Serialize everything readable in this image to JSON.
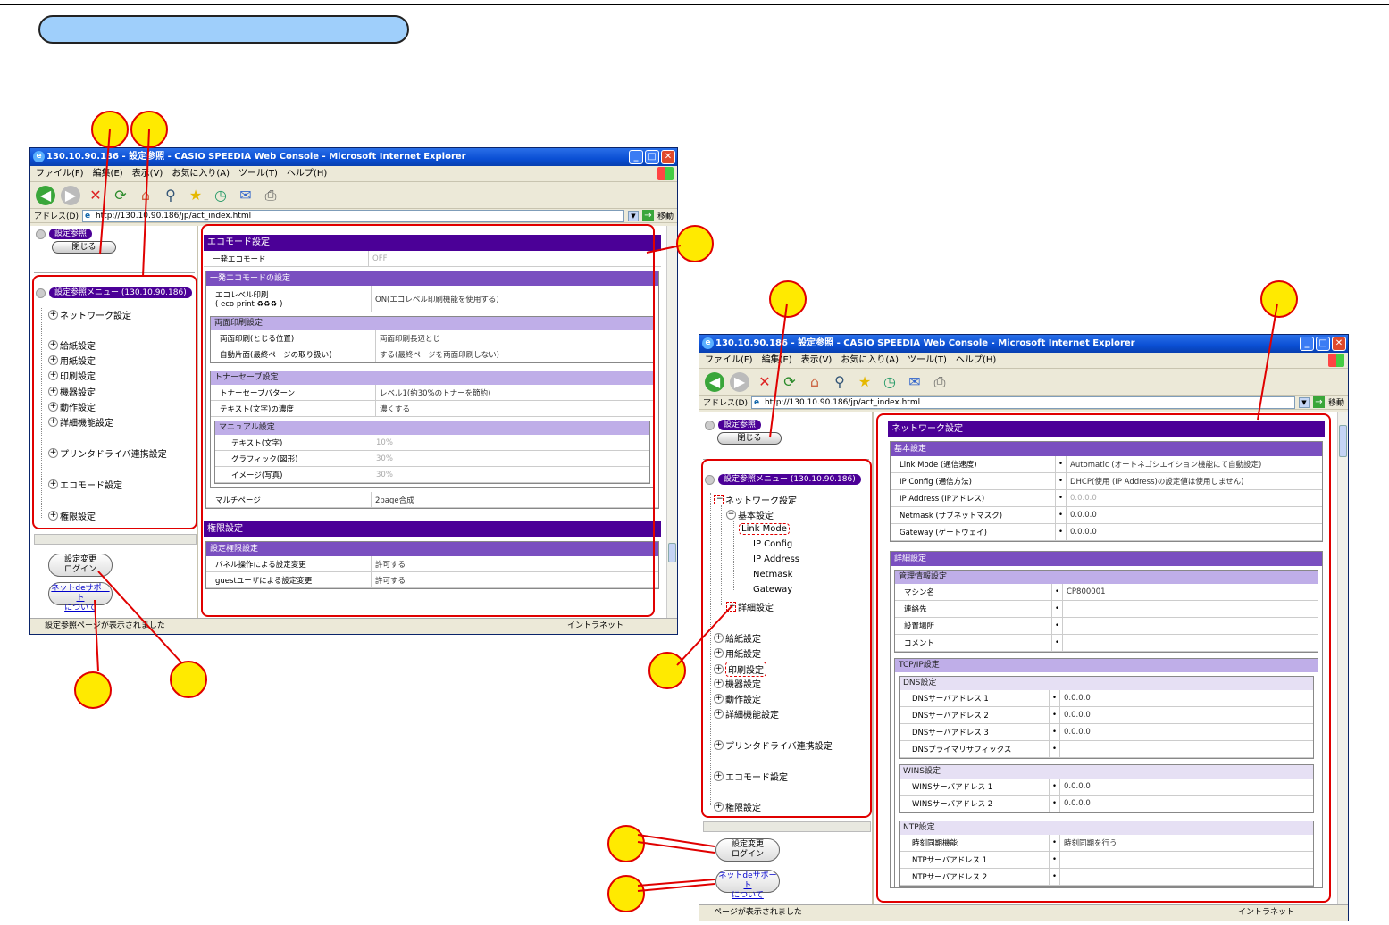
{
  "window": {
    "title": "130.10.90.186 - 設定参照 - CASIO SPEEDIA Web Console - Microsoft Internet Explorer",
    "menu": [
      "ファイル(F)",
      "編集(E)",
      "表示(V)",
      "お気に入り(A)",
      "ツール(T)",
      "ヘルプ(H)"
    ],
    "address_label": "アドレス(D)",
    "address": "http://130.10.90.186/jp/act_index.html",
    "go_label": "移動",
    "zone": "イントラネット"
  },
  "left_window": {
    "status": "設定参照ページが表示されました",
    "content": {
      "eco_title": "エコモード設定",
      "eco_general_label": "一発エコモード",
      "eco_general_value": "OFF",
      "eco_sub_title": "一発エコモードの設定",
      "eco_level_label": "エコレベル印刷",
      "eco_level_label2": "( eco print",
      "eco_level_glyphs": "♻♻♻",
      "eco_level_close": ")",
      "eco_level_value": "ON(エコレベル印刷機能を使用する)",
      "duplex_title": "両面印刷設定",
      "duplex_rows": [
        {
          "k": "両面印刷(とじる位置)",
          "v": "両面印刷長辺とじ"
        },
        {
          "k": "自動片面(最終ページの取り扱い)",
          "v": "する(最終ページを両面印刷しない)"
        }
      ],
      "toner_title": "トナーセーブ設定",
      "toner_rows": [
        {
          "k": "トナーセーブパターン",
          "v": "レベル1(約30%のトナーを節約)"
        },
        {
          "k": "テキスト(文字)の濃度",
          "v": "濃くする"
        }
      ],
      "manual_title": "マニュアル設定",
      "manual_rows": [
        {
          "k": "テキスト(文字)",
          "v": "10%"
        },
        {
          "k": "グラフィック(図形)",
          "v": "30%"
        },
        {
          "k": "イメージ(写真)",
          "v": "30%"
        }
      ],
      "multipage_label": "マルチページ",
      "multipage_value": "2page合成",
      "auth_title": "権限設定",
      "auth_sub": "設定権限設定",
      "auth_rows": [
        {
          "k": "パネル操作による設定変更",
          "v": "許可する"
        },
        {
          "k": "guestユーザによる設定変更",
          "v": "許可する"
        }
      ]
    }
  },
  "sidebar": {
    "ref_label": "設定参照",
    "close_label": "閉じる",
    "menu_label": "設定参照メニュー (130.10.90.186)",
    "items": [
      "ネットワーク設定",
      "給紙設定",
      "用紙設定",
      "印刷設定",
      "機器設定",
      "動作設定",
      "詳細機能設定",
      "プリンタドライバ連携設定",
      "エコモード設定",
      "権限設定"
    ],
    "network_children": [
      "基本設定",
      "Link Mode",
      "IP Config",
      "IP Address",
      "Netmask",
      "Gateway",
      "詳細設定"
    ],
    "login_line1": "設定変更",
    "login_line2": "ログイン",
    "support_line1": "ネットdeサポート",
    "support_line2": "について"
  },
  "right_window": {
    "status": "ページが表示されました",
    "content": {
      "net_title": "ネットワーク設定",
      "basic_title": "基本設定",
      "basic_rows": [
        {
          "k": "Link Mode (通信速度)",
          "v": "Automatic (オートネゴシエイション機能にて自動設定)",
          "gray": false
        },
        {
          "k": "IP Config (通信方法)",
          "v": "DHCP(使用 (IP Address)の設定値は使用しません)",
          "gray": false
        },
        {
          "k": "IP Address (IPアドレス)",
          "v": "0.0.0.0",
          "gray": true
        },
        {
          "k": "Netmask (サブネットマスク)",
          "v": "0.0.0.0",
          "gray": false
        },
        {
          "k": "Gateway (ゲートウェイ)",
          "v": "0.0.0.0",
          "gray": false
        }
      ],
      "detail_title": "詳細設定",
      "mgmt_title": "管理情報設定",
      "mgmt_rows": [
        {
          "k": "マシン名",
          "v": "CP800001"
        },
        {
          "k": "連絡先",
          "v": ""
        },
        {
          "k": "設置場所",
          "v": ""
        },
        {
          "k": "コメント",
          "v": ""
        }
      ],
      "tcp_title": "TCP/IP設定",
      "dns_title": "DNS設定",
      "dns_rows": [
        {
          "k": "DNSサーバアドレス 1",
          "v": "0.0.0.0"
        },
        {
          "k": "DNSサーバアドレス 2",
          "v": "0.0.0.0"
        },
        {
          "k": "DNSサーバアドレス 3",
          "v": "0.0.0.0"
        },
        {
          "k": "DNSプライマリサフィックス",
          "v": ""
        }
      ],
      "wins_title": "WINS設定",
      "wins_rows": [
        {
          "k": "WINSサーバアドレス 1",
          "v": "0.0.0.0"
        },
        {
          "k": "WINSサーバアドレス 2",
          "v": "0.0.0.0"
        }
      ],
      "ntp_title": "NTP設定",
      "ntp_rows": [
        {
          "k": "時刻同期機能",
          "v": "時刻同期を行う"
        },
        {
          "k": "NTPサーバアドレス 1",
          "v": ""
        },
        {
          "k": "NTPサーバアドレス 2",
          "v": ""
        }
      ]
    }
  },
  "colors": {
    "callout_fill": "#ffea00",
    "callout_border": "#e00000",
    "section_header": "#4b0097",
    "heading_pill": "#9fcffb"
  }
}
